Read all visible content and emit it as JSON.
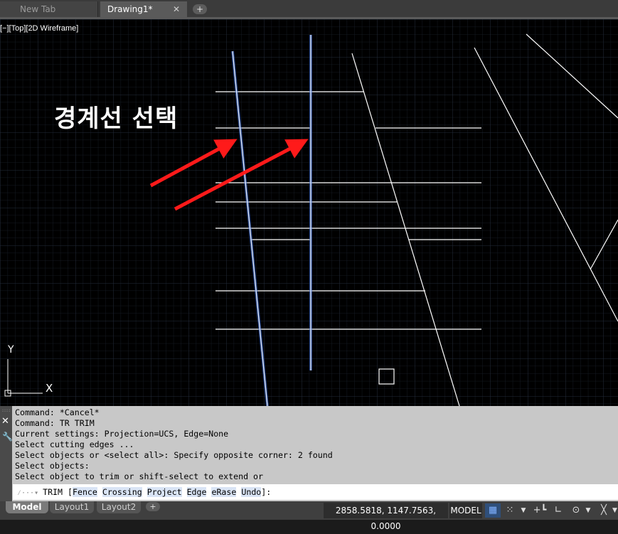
{
  "tabs": [
    {
      "label": "New Tab"
    },
    {
      "label": "Drawing1*",
      "close": "✕"
    }
  ],
  "tab_add": "+",
  "viewport": {
    "view_label": "[−][Top][2D Wireframe]",
    "annotation": "경계선 선택",
    "ucs": {
      "y": "Y",
      "x": "X"
    }
  },
  "command": {
    "history": [
      "Command: *Cancel*",
      "Command: TR TRIM",
      "Current settings: Projection=UCS, Edge=None",
      "Select cutting edges ...",
      "Select objects or <select all>: Specify opposite corner: 2 found",
      "Select objects:",
      "Select object to trim or shift-select to extend or"
    ],
    "prompt": {
      "command": "TRIM",
      "open": " [",
      "options": [
        "Fence",
        "Crossing",
        "Project",
        "Edge",
        "eRase",
        "Undo"
      ],
      "close": "]:"
    }
  },
  "layouts": [
    "Model",
    "Layout1",
    "Layout2"
  ],
  "layout_add": "+",
  "status": {
    "coordinates": "2858.5818, 1147.7563, 0.0000",
    "model": "MODEL"
  },
  "colors": {
    "background": "#000000",
    "selected_line": "#6f9cff",
    "annotation_arrow": "#ff1a1a",
    "grid": "#1c2430"
  },
  "icons": [
    "grid-icon",
    "snap-icon",
    "ortho-icon",
    "polar-icon",
    "isodraft-icon"
  ]
}
